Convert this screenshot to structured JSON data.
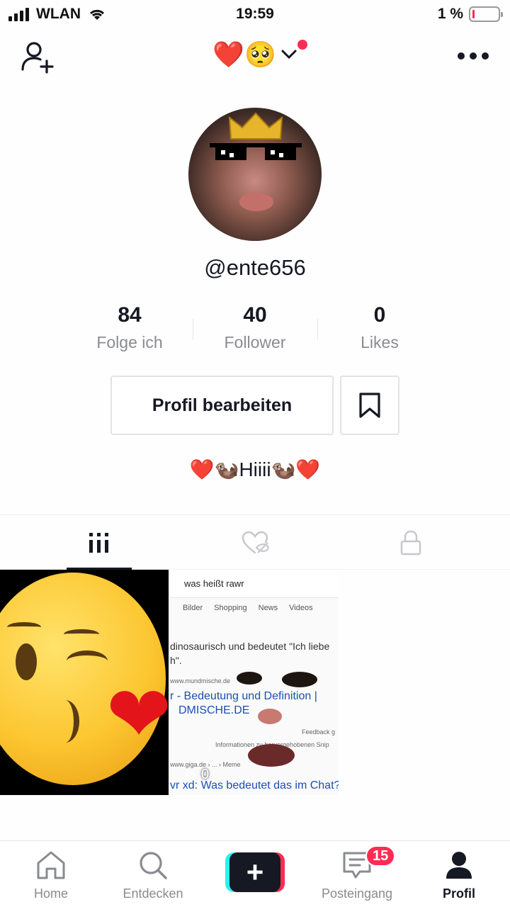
{
  "status_bar": {
    "carrier": "WLAN",
    "time": "19:59",
    "battery_percent": "1 %",
    "battery_level": 0.01
  },
  "top_nav": {
    "title": "❤️🥺",
    "add_user_icon": "add-user-icon",
    "more_icon": "more-icon",
    "has_notification_dot": true
  },
  "profile": {
    "username": "@ente656",
    "bio": "❤️🦦Hiiii🦦❤️"
  },
  "stats": [
    {
      "value": "84",
      "label": "Folge ich"
    },
    {
      "value": "40",
      "label": "Follower"
    },
    {
      "value": "0",
      "label": "Likes"
    }
  ],
  "actions": {
    "edit_profile_label": "Profil bearbeiten",
    "bookmark_icon": "bookmark-icon"
  },
  "tabs": [
    {
      "icon": "videos-grid-icon",
      "active": true
    },
    {
      "icon": "liked-hidden-icon",
      "active": false
    },
    {
      "icon": "lock-icon",
      "active": false
    }
  ],
  "videos": [
    {
      "thumbnail": "kissing-face-emoji"
    },
    {
      "thumbnail": "search-screenshot",
      "search_query": "was heißt rawr",
      "search_tabs": [
        "Bilder",
        "Shopping",
        "News",
        "Videos"
      ],
      "snippet_line1": "dinosaurisch und bedeutet \"Ich liebe",
      "snippet_line2": "h\".",
      "source1": "www.mundmische.de",
      "link1a": "r - Bedeutung und Definition |",
      "link1b": "DMISCHE.DE",
      "feedback": "Feedback g",
      "info": "Informationen zu hervorgehobenen Snip",
      "source2": "www.giga.de › ... › Meme",
      "link2": "vr xd: Was bedeutet das im Chat?",
      "views": "0"
    }
  ],
  "bottom_nav": [
    {
      "label": "Home",
      "icon": "home-icon"
    },
    {
      "label": "Entdecken",
      "icon": "search-icon"
    },
    {
      "label": "",
      "icon": "plus-icon"
    },
    {
      "label": "Posteingang",
      "icon": "inbox-icon",
      "badge": "15"
    },
    {
      "label": "Profil",
      "icon": "profile-icon",
      "active": true
    }
  ],
  "colors": {
    "accent": "#fe2c55",
    "cyan": "#25f4ee",
    "text_primary": "#161823",
    "text_secondary": "#8a8b91"
  }
}
